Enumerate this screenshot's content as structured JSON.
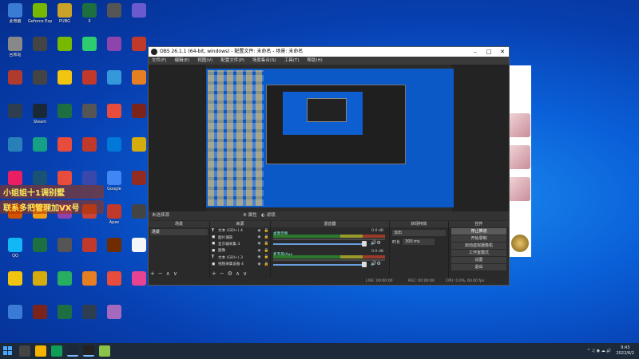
{
  "desktop": {
    "icons": [
      {
        "label": "此电脑",
        "color": "#3a7bd5"
      },
      {
        "label": "Geforce Experience",
        "color": "#76b900"
      },
      {
        "label": "PUBG",
        "color": "#c9a227"
      },
      {
        "label": "X",
        "color": "#1d6f42"
      },
      {
        "label": "",
        "color": "#555"
      },
      {
        "label": "",
        "color": "#6a5acd"
      },
      {
        "label": "回收站",
        "color": "#888"
      },
      {
        "label": "",
        "color": "#444"
      },
      {
        "label": "",
        "color": "#76b900"
      },
      {
        "label": "",
        "color": "#2ecc71"
      },
      {
        "label": "",
        "color": "#8e44ad"
      },
      {
        "label": "",
        "color": "#c0392b"
      },
      {
        "label": "",
        "color": "#b03a2e"
      },
      {
        "label": "",
        "color": "#444"
      },
      {
        "label": "",
        "color": "#f1c40f"
      },
      {
        "label": "",
        "color": "#c0392b"
      },
      {
        "label": "",
        "color": "#3498db"
      },
      {
        "label": "",
        "color": "#e67e22"
      },
      {
        "label": "",
        "color": "#2c3e50"
      },
      {
        "label": "Steam",
        "color": "#1b2838"
      },
      {
        "label": "",
        "color": "#1d6f42"
      },
      {
        "label": "",
        "color": "#555"
      },
      {
        "label": "",
        "color": "#e74c3c"
      },
      {
        "label": "",
        "color": "#7b241c"
      },
      {
        "label": "",
        "color": "#2980b9"
      },
      {
        "label": "",
        "color": "#16a085"
      },
      {
        "label": "",
        "color": "#e74c3c"
      },
      {
        "label": "",
        "color": "#c0392b"
      },
      {
        "label": "",
        "color": "#0078d7"
      },
      {
        "label": "",
        "color": "#d4ac0d"
      },
      {
        "label": "",
        "color": "#e91e63"
      },
      {
        "label": "",
        "color": "#1a5276"
      },
      {
        "label": "",
        "color": "#e74c3c"
      },
      {
        "label": "",
        "color": "#3949ab"
      },
      {
        "label": "Google",
        "color": "#4285f4"
      },
      {
        "label": "",
        "color": "#922b21"
      },
      {
        "label": "",
        "color": "#d35400"
      },
      {
        "label": "",
        "color": "#f39c12"
      },
      {
        "label": "",
        "color": "#8e44ad"
      },
      {
        "label": "",
        "color": "#cb4335"
      },
      {
        "label": "Apex",
        "color": "#c0392b"
      },
      {
        "label": "",
        "color": "#444"
      },
      {
        "label": "QQ",
        "color": "#12b7f5"
      },
      {
        "label": "",
        "color": "#1d6f42"
      },
      {
        "label": "",
        "color": "#555"
      },
      {
        "label": "",
        "color": "#c0392b"
      },
      {
        "label": "",
        "color": "#6e2c00"
      },
      {
        "label": "",
        "color": "#f4f6f7"
      },
      {
        "label": "",
        "color": "#f1c40f"
      },
      {
        "label": "",
        "color": "#d4ac0d"
      },
      {
        "label": "",
        "color": "#27ae60"
      },
      {
        "label": "",
        "color": "#e67e22"
      },
      {
        "label": "",
        "color": "#e74c3c"
      },
      {
        "label": "",
        "color": "#e84393"
      },
      {
        "label": "",
        "color": "#3a7bd5"
      },
      {
        "label": "",
        "color": "#7b241c"
      },
      {
        "label": "",
        "color": "#1d6f42"
      },
      {
        "label": "",
        "color": "#2c3e50"
      },
      {
        "label": "",
        "color": "#a569bd"
      }
    ],
    "banner_line1": "小姐姐十1调别墅",
    "banner_line2": "联系多把管理加VX号"
  },
  "obs": {
    "title": "OBS 26.1.1 (64-bit, windows) - 配置文件: 未命名 - 场景: 未命名",
    "menu": [
      "文件(F)",
      "编辑(E)",
      "视图(V)",
      "配置文件(P)",
      "场景集合(S)",
      "工具(T)",
      "帮助(H)"
    ],
    "scene_bar": {
      "label": "未选择源",
      "properties": "属性",
      "filters": "滤镜"
    },
    "docks": {
      "scenes": {
        "title": "场景",
        "items": [
          "场景"
        ]
      },
      "sources": {
        "title": "来源",
        "items": [
          {
            "type": "T",
            "name": "文本 (GDI+) 4"
          },
          {
            "type": "▣",
            "name": "图片捕获"
          },
          {
            "type": "▣",
            "name": "显示器采集 3"
          },
          {
            "type": "▣",
            "name": "图像"
          },
          {
            "type": "T",
            "name": "文本 (GDI+) 3"
          },
          {
            "type": "▣",
            "name": "视频采集设备 4"
          }
        ]
      },
      "mixer": {
        "title": "混音器",
        "tracks": [
          {
            "name": "桌面音频",
            "db": "0.0 dB"
          },
          {
            "name": "麦克风/Aux",
            "db": "0.0 dB"
          }
        ]
      },
      "transitions": {
        "title": "转场特效",
        "selected": "淡出",
        "duration_label": "时长",
        "duration_value": "300 ms"
      },
      "controls": {
        "title": "控件",
        "buttons": [
          "停止推流",
          "开始录制",
          "启动虚拟摄像机",
          "工作室模式",
          "设置",
          "退出"
        ]
      }
    },
    "status": {
      "live": "LIVE: 00:00:00",
      "rec": "REC: 00:00:00",
      "cpu": "CPU: 0.0%, 60.00 fps"
    }
  },
  "taskbar": {
    "time": "9:43",
    "date": "2022/6/2"
  }
}
